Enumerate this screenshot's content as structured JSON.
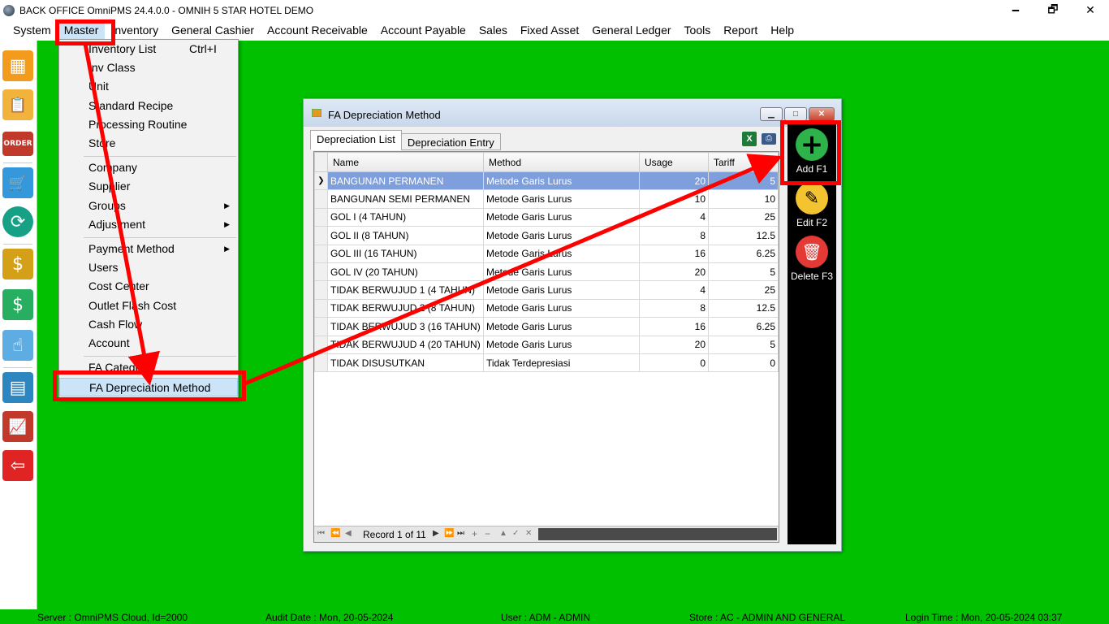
{
  "window": {
    "title": "BACK OFFICE OmniPMS 24.4.0.0 - OMNIH 5 STAR HOTEL DEMO",
    "minimize": "🗕",
    "maximize": "🗗",
    "close": "✕"
  },
  "menubar": [
    "System",
    "Master",
    "Inventory",
    "General Cashier",
    "Account Receivable",
    "Account Payable",
    "Sales",
    "Fixed Asset",
    "General Ledger",
    "Tools",
    "Report",
    "Help"
  ],
  "dropdown": {
    "items": [
      {
        "label": "Inventory List",
        "shortcut": "Ctrl+I"
      },
      {
        "label": "Inv Class"
      },
      {
        "label": "Unit"
      },
      {
        "label": "Standard Recipe"
      },
      {
        "label": "Processing Routine"
      },
      {
        "label": "Store"
      },
      {
        "label": "Company"
      },
      {
        "label": "Supplier"
      },
      {
        "label": "Groups",
        "submenu": true
      },
      {
        "label": "Adjustment",
        "submenu": true
      },
      {
        "label": "Payment Method",
        "submenu": true
      },
      {
        "label": "Users"
      },
      {
        "label": "Cost Center"
      },
      {
        "label": "Outlet Flash Cost"
      },
      {
        "label": "Cash Flow"
      },
      {
        "label": "Account"
      },
      {
        "label": "FA Category"
      },
      {
        "label": "FA Depreciation Method"
      }
    ]
  },
  "fa_window": {
    "title": "FA Depreciation Method",
    "tabs": [
      "Depreciation List",
      "Depreciation Entry"
    ],
    "columns": [
      "Name",
      "Method",
      "Usage",
      "Tariff"
    ],
    "rows": [
      {
        "name": "BANGUNAN PERMANEN",
        "method": "Metode Garis Lurus",
        "usage": "20",
        "tariff": "5"
      },
      {
        "name": "BANGUNAN SEMI PERMANEN",
        "method": "Metode Garis Lurus",
        "usage": "10",
        "tariff": "10"
      },
      {
        "name": "GOL I (4 TAHUN)",
        "method": "Metode Garis Lurus",
        "usage": "4",
        "tariff": "25"
      },
      {
        "name": "GOL II (8 TAHUN)",
        "method": "Metode Garis Lurus",
        "usage": "8",
        "tariff": "12.5"
      },
      {
        "name": "GOL III (16 TAHUN)",
        "method": "Metode Garis Lurus",
        "usage": "16",
        "tariff": "6.25"
      },
      {
        "name": "GOL IV (20 TAHUN)",
        "method": "Metode Garis Lurus",
        "usage": "20",
        "tariff": "5"
      },
      {
        "name": "TIDAK BERWUJUD 1 (4 TAHUN)",
        "method": "Metode Garis Lurus",
        "usage": "4",
        "tariff": "25"
      },
      {
        "name": "TIDAK BERWUJUD 2 (8 TAHUN)",
        "method": "Metode Garis Lurus",
        "usage": "8",
        "tariff": "12.5"
      },
      {
        "name": "TIDAK BERWUJUD 3 (16 TAHUN)",
        "method": "Metode Garis Lurus",
        "usage": "16",
        "tariff": "6.25"
      },
      {
        "name": "TIDAK BERWUJUD 4 (20 TAHUN)",
        "method": "Metode Garis Lurus",
        "usage": "20",
        "tariff": "5"
      },
      {
        "name": "TIDAK DISUSUTKAN",
        "method": "Tidak Terdepresiasi",
        "usage": "0",
        "tariff": "0"
      }
    ],
    "record_text": "Record 1 of 11",
    "excel_glyph": "X",
    "print_glyph": "⎙",
    "actions": [
      {
        "label": "Add F1",
        "glyph": "+",
        "color": "#2db34a",
        "icon": "plus-circle-icon"
      },
      {
        "label": "Edit F2",
        "glyph": "✎",
        "color": "#f4c430",
        "icon": "edit-icon"
      },
      {
        "label": "Delete F3",
        "glyph": "🗑",
        "color": "#e53935",
        "icon": "trash-icon"
      }
    ]
  },
  "navigator": [
    "⏮",
    "⏪",
    "◀",
    "▶",
    "⏩",
    "⏭",
    "+",
    "−",
    "▲",
    "✓",
    "✕"
  ],
  "status": {
    "server": "Server : OmniPMS Cloud, Id=2000",
    "audit": "Audit Date : Mon, 20-05-2024",
    "user": "User : ADM - ADMIN",
    "store": "Store : AC - ADMIN AND GENERAL",
    "login": "Login Time : Mon, 20-05-2024 03:37"
  },
  "toolbar_icons": [
    {
      "icon": "inventory-boxes-icon",
      "color": "#f29b1c",
      "glyph": "▦"
    },
    {
      "icon": "clipboard-icon",
      "color": "#f2b33c",
      "glyph": "📋"
    },
    {
      "icon": "order-icon",
      "color": "#c0392b",
      "glyph": "ORDER"
    },
    {
      "icon": "cart-icon",
      "color": "#3498db",
      "glyph": "🛒"
    },
    {
      "icon": "sync-icon",
      "color": "#16a085",
      "glyph": "⟳"
    },
    {
      "icon": "money-bag-icon",
      "color": "#d4a017",
      "glyph": "$"
    },
    {
      "icon": "hand-money-icon",
      "color": "#27ae60",
      "glyph": "$"
    },
    {
      "icon": "touch-phone-icon",
      "color": "#5dade2",
      "glyph": "☝"
    },
    {
      "icon": "calendar-icon",
      "color": "#2e86c1",
      "glyph": "▤"
    },
    {
      "icon": "chart-icon",
      "color": "#c0392b",
      "glyph": "📈"
    },
    {
      "icon": "exit-icon",
      "color": "#e02424",
      "glyph": "⇦"
    }
  ],
  "colors": {
    "desktop": "#00c000",
    "highlight": "#ff0000",
    "selected_row": "#7f9fdc"
  }
}
